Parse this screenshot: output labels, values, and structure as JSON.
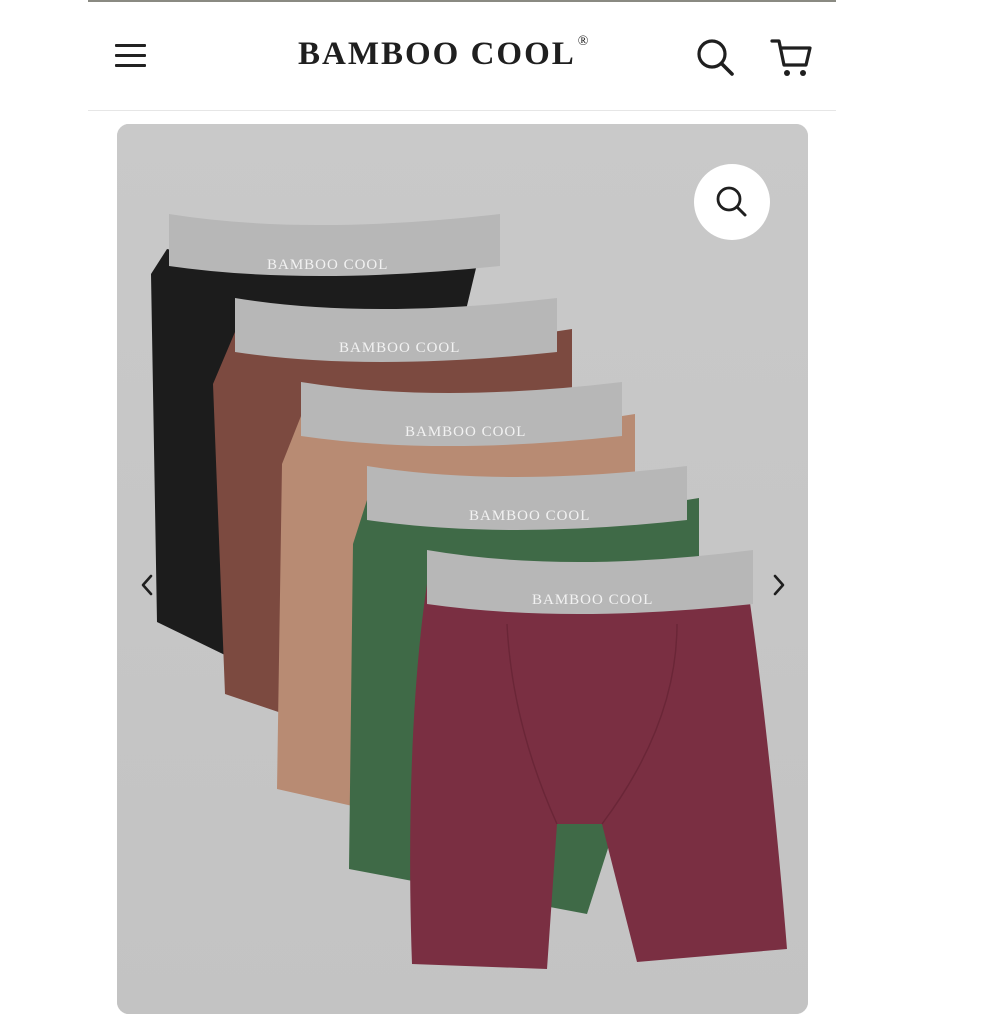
{
  "header": {
    "logo_text": "BAMBOO COOL",
    "logo_mark": "®",
    "menu_icon": "hamburger-menu-icon",
    "search_icon": "search-icon",
    "cart_icon": "shopping-cart-icon"
  },
  "gallery": {
    "zoom_icon": "zoom-magnifier-icon",
    "prev_icon": "chevron-left-icon",
    "next_icon": "chevron-right-icon",
    "product": {
      "waistband_text": "BAMBOO COOL",
      "colors": {
        "black": "#1c1c1c",
        "brown": "#7c4a40",
        "tan": "#b88b73",
        "green": "#3f6a47",
        "burgundy": "#7a2f42",
        "waistband": "#b7b7b7"
      }
    }
  }
}
